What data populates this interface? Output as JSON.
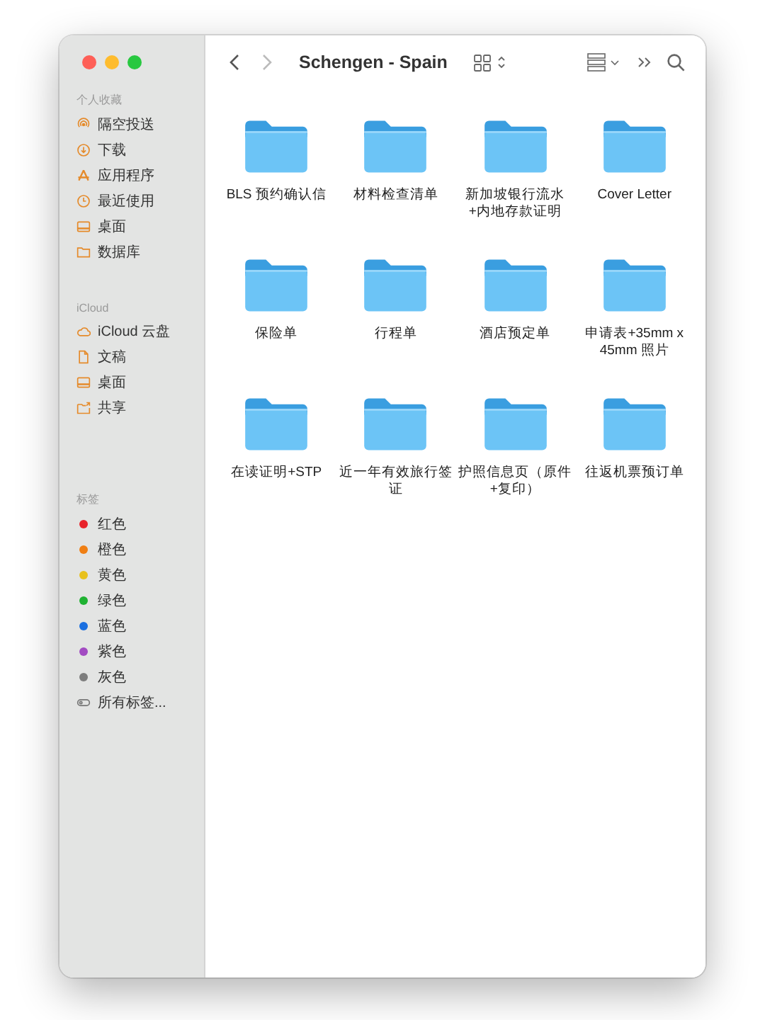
{
  "window": {
    "title": "Schengen - Spain"
  },
  "toolbar": {
    "back": {
      "disabled": false
    },
    "forward": {
      "disabled": true
    }
  },
  "sidebar": {
    "sections": [
      {
        "heading": "个人收藏",
        "items": [
          {
            "label": "隔空投送",
            "kind": "airdrop"
          },
          {
            "label": "下载",
            "kind": "download"
          },
          {
            "label": "应用程序",
            "kind": "apps"
          },
          {
            "label": "最近使用",
            "kind": "recent"
          },
          {
            "label": "桌面",
            "kind": "desktop"
          },
          {
            "label": "数据库",
            "kind": "folder"
          }
        ]
      },
      {
        "heading": "iCloud",
        "items": [
          {
            "label": "iCloud 云盘",
            "kind": "cloud"
          },
          {
            "label": "文稿",
            "kind": "document"
          },
          {
            "label": "桌面",
            "kind": "desktop"
          },
          {
            "label": "共享",
            "kind": "shared"
          }
        ]
      }
    ],
    "tags": {
      "heading": "标签",
      "items": [
        {
          "label": "红色",
          "color": "#e8232b"
        },
        {
          "label": "橙色",
          "color": "#f07f14"
        },
        {
          "label": "黄色",
          "color": "#e8c11c"
        },
        {
          "label": "绿色",
          "color": "#1fb232"
        },
        {
          "label": "蓝色",
          "color": "#1a6fe0"
        },
        {
          "label": "紫色",
          "color": "#a24bc2"
        },
        {
          "label": "灰色",
          "color": "#7d7d7d"
        }
      ],
      "all_tags": "所有标签..."
    }
  },
  "folders": [
    {
      "name": "BLS 预约确认信"
    },
    {
      "name": "材料检查清单"
    },
    {
      "name": "新加坡银行流水+内地存款证明"
    },
    {
      "name": "Cover Letter"
    },
    {
      "name": "保险单"
    },
    {
      "name": "行程单"
    },
    {
      "name": "酒店预定单"
    },
    {
      "name": "申请表+35mm x 45mm 照片"
    },
    {
      "name": "在读证明+STP"
    },
    {
      "name": "近一年有效旅行签证"
    },
    {
      "name": "护照信息页（原件+复印）"
    },
    {
      "name": "往返机票预订单"
    }
  ]
}
